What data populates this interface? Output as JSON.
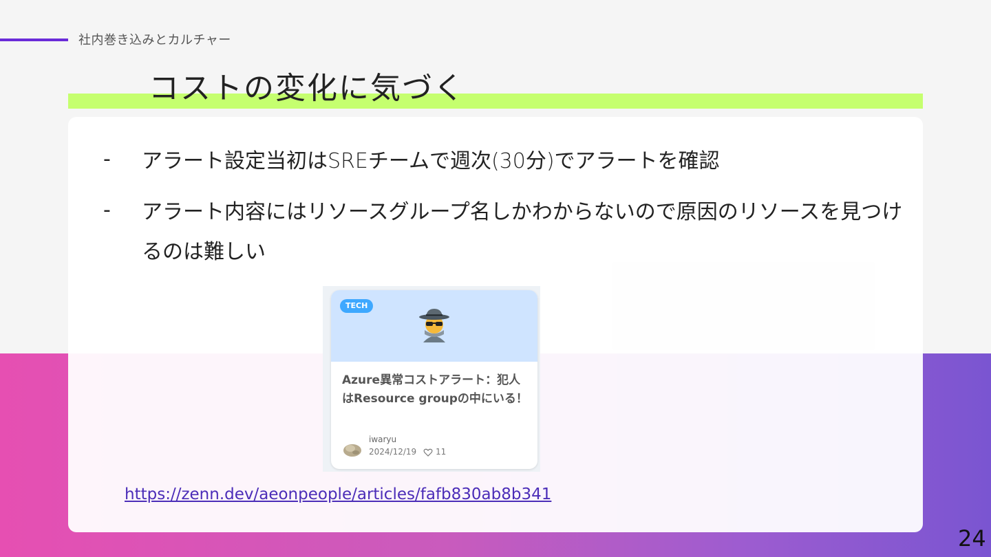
{
  "section": {
    "label": "社内巻き込みとカルチャー"
  },
  "slide": {
    "title": "コストの変化に気づく",
    "bullets": [
      {
        "marker": "-",
        "text": "アラート設定当初はSREチームで週次(30分)でアラートを確認"
      },
      {
        "marker": "-",
        "text": "アラート内容にはリソースグループ名しかわからないので原因のリソースを見つけるのは難しい"
      }
    ],
    "page_number": "24"
  },
  "link_card": {
    "badge": "TECH",
    "emoji_icon": "detective-icon",
    "title": "Azure異常コストアラート：犯人はResource groupの中にいる！",
    "author": "iwaryu",
    "date": "2024/12/19",
    "likes": "11",
    "avatar_icon": "rock-avatar-icon",
    "like_icon": "heart-icon"
  },
  "link": {
    "url": "https://zenn.dev/aeonpeople/articles/fafb830ab8b341"
  },
  "colors": {
    "accent_line": "#6a2bd8",
    "title_highlight": "#c5ff6f",
    "gradient_start": "#e64fb2",
    "gradient_end": "#7a55d1",
    "badge": "#3ea8ff",
    "link": "#4b2db8"
  }
}
